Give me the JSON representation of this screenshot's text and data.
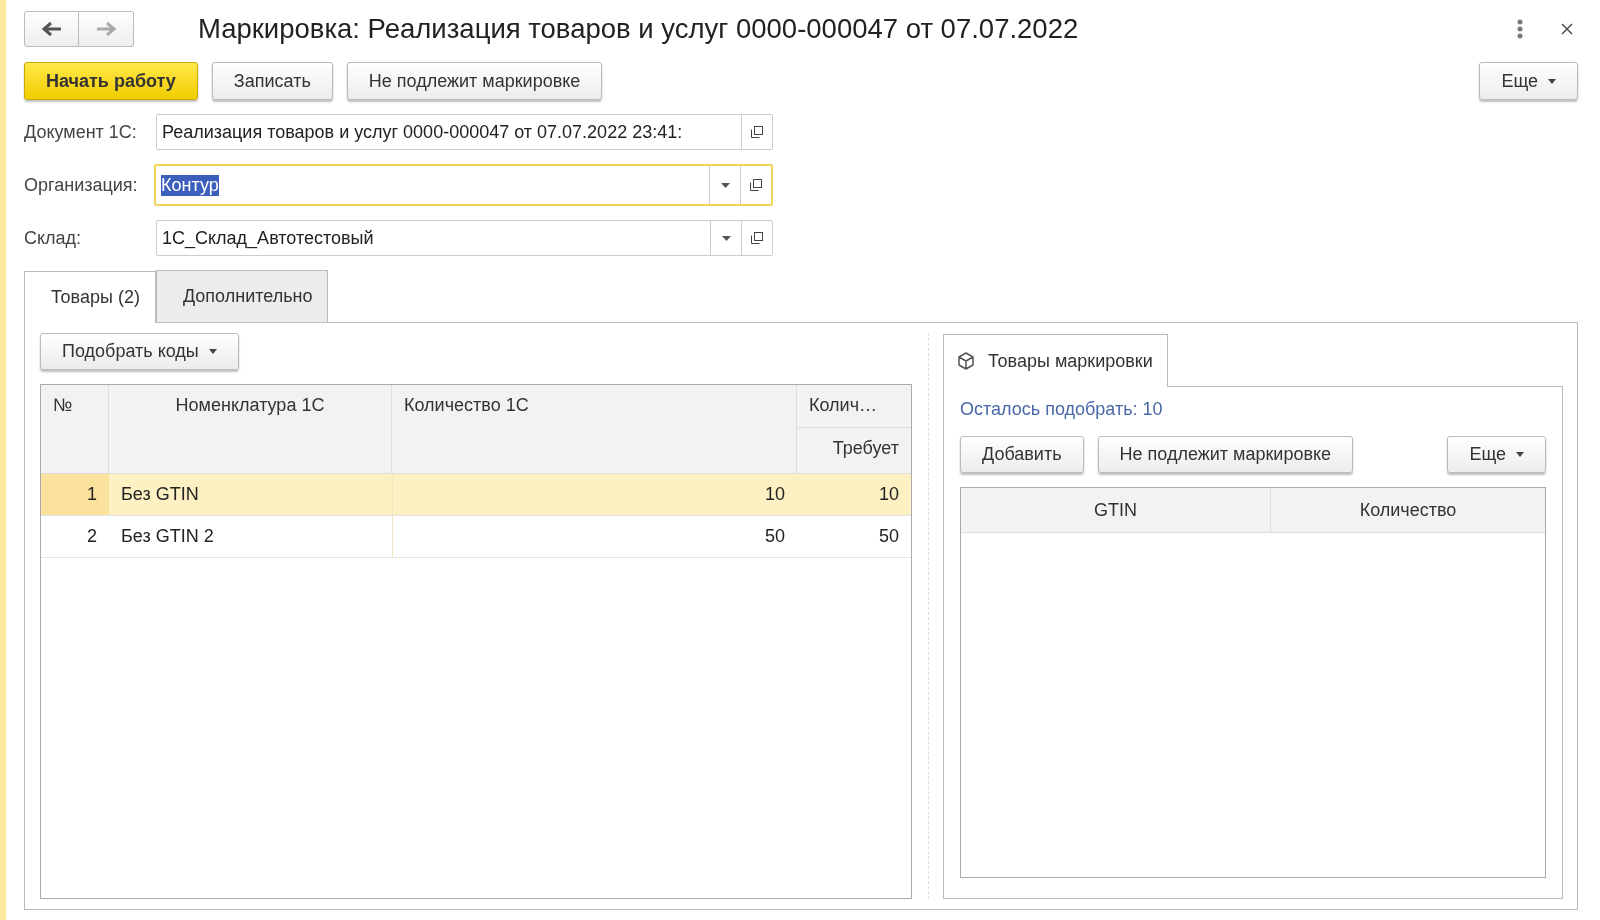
{
  "window": {
    "title": "Маркировка: Реализация товаров и услуг 0000-000047 от 07.07.2022"
  },
  "toolbar": {
    "buttons": [
      {
        "label": "Начать работу",
        "kind": "primary"
      },
      {
        "label": "Записать",
        "kind": "normal"
      },
      {
        "label": "Не подлежит маркировке",
        "kind": "normal"
      }
    ],
    "more": "Еще"
  },
  "fields": [
    {
      "label": "Документ 1С:",
      "value": "Реализация товаров и услуг 0000-000047 от 07.07.2022 23:41:",
      "kind": "text",
      "focused": false
    },
    {
      "label": "Организация:",
      "value": "Контур",
      "kind": "dropdown",
      "focused": true
    },
    {
      "label": "Склад:",
      "value": "1С_Склад_Автотестовый",
      "kind": "dropdown",
      "focused": false
    }
  ],
  "tabs": [
    {
      "label": "Товары (2)",
      "selected": true
    },
    {
      "label": "Дополнительно",
      "selected": false
    }
  ],
  "goods": {
    "pick_button": "Подобрать коды",
    "columns": [
      {
        "label": "№"
      },
      {
        "label": "Номенклатура 1С"
      },
      {
        "label": "Количество 1С"
      },
      {
        "label": "Колич…",
        "sub": "Требует"
      }
    ],
    "rows": [
      {
        "number": "1",
        "name": "Без GTIN",
        "quantity_1c": "10",
        "required": "10",
        "selected": true
      },
      {
        "number": "2",
        "name": "Без GTIN 2",
        "quantity_1c": "50",
        "required": "50",
        "selected": false
      }
    ]
  },
  "marking": {
    "tab": "Товары маркировки",
    "remaining": "Осталось подобрать: 10",
    "buttons": [
      "Добавить",
      "Не подлежит маркировке"
    ],
    "more": "Еще",
    "columns": [
      "GTIN",
      "Количество"
    ]
  }
}
